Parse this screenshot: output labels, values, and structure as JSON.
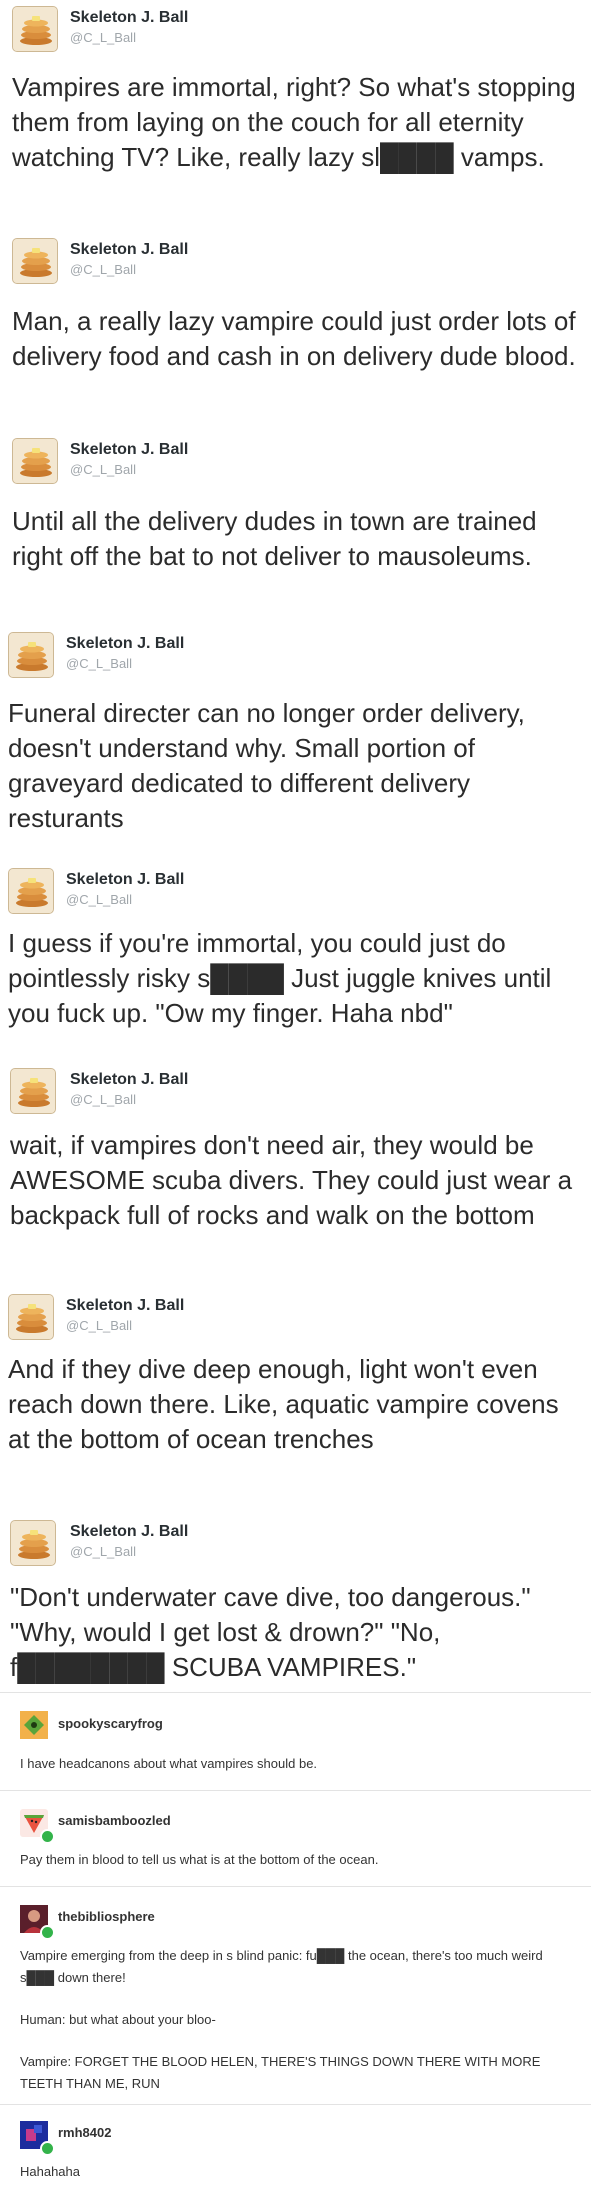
{
  "tweets": [
    {
      "name": "Skeleton J. Ball",
      "handle": "@C_L_Ball",
      "text": "Vampires are immortal, right? So what's stopping them from laying on the couch for all eternity watching TV? Like, really lazy sl████ vamps."
    },
    {
      "name": "Skeleton J. Ball",
      "handle": "@C_L_Ball",
      "text": "Man, a really lazy vampire could just order lots of delivery food and cash in on delivery dude blood."
    },
    {
      "name": "Skeleton J. Ball",
      "handle": "@C_L_Ball",
      "text": "Until all the delivery dudes in town are trained right off the bat to not deliver to mausoleums."
    },
    {
      "name": "Skeleton J. Ball",
      "handle": "@C_L_Ball",
      "text": "Funeral directer can no longer order delivery, doesn't understand why. Small portion of graveyard dedicated to different delivery resturants"
    },
    {
      "name": "Skeleton J. Ball",
      "handle": "@C_L_Ball",
      "text": "I guess if you're immortal, you could just do pointlessly risky s████ Just juggle knives until you fuck up. \"Ow my finger. Haha nbd\""
    },
    {
      "name": "Skeleton J. Ball",
      "handle": "@C_L_Ball",
      "text": "wait, if vampires don't need air, they would be AWESOME scuba divers. They could just wear a backpack full of rocks and walk on the bottom"
    },
    {
      "name": "Skeleton J. Ball",
      "handle": "@C_L_Ball",
      "text": "And if they dive deep enough, light won't even reach down there. Like, aquatic vampire covens at the bottom of ocean trenches"
    },
    {
      "name": "Skeleton J. Ball",
      "handle": "@C_L_Ball",
      "text": "\"Don't underwater cave dive, too dangerous.\" \"Why, would I get lost & drown?\" \"No, f████████ SCUBA VAMPIRES.\""
    }
  ],
  "comments": [
    {
      "name": "spookyscaryfrog",
      "avatar_color": "#f5a623",
      "paragraphs": [
        "I have headcanons about what vampires should be."
      ]
    },
    {
      "name": "samisbamboozled",
      "avatar_color": "#e9533f",
      "paragraphs": [
        "Pay them in blood to tell us what is at the bottom of the ocean."
      ]
    },
    {
      "name": "thebibliosphere",
      "avatar_color": "#7a2a3a",
      "paragraphs": [
        "Vampire emerging from the deep in s blind panic: fu███ the ocean, there's too much weird s███ down there!",
        "Human: but what about your bloo-",
        "Vampire: FORGET THE BLOOD HELEN, THERE'S THINGS DOWN THERE WITH MORE TEETH THAN ME, RUN"
      ]
    },
    {
      "name": "rmh8402",
      "avatar_color": "#1d2c9e",
      "paragraphs": [
        "Hahahaha"
      ]
    }
  ]
}
